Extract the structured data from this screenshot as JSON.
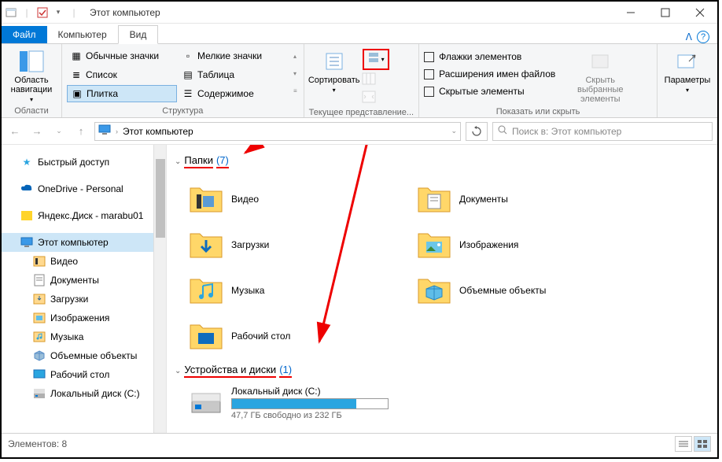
{
  "title": "Этот компьютер",
  "tabs": {
    "file": "Файл",
    "computer": "Компьютер",
    "view": "Вид"
  },
  "ribbon": {
    "navpane": {
      "btn": "Область навигации",
      "group": "Области"
    },
    "layout": {
      "opts": [
        "Обычные значки",
        "Мелкие значки",
        "Список",
        "Таблица",
        "Плитка",
        "Содержимое"
      ],
      "group": "Структура"
    },
    "sort": {
      "btn": "Сортировать",
      "group": "Текущее представление..."
    },
    "show": {
      "chk1": "Флажки элементов",
      "chk2": "Расширения имен файлов",
      "chk3": "Скрытые элементы",
      "hidebtn": "Скрыть выбранные элементы",
      "group": "Показать или скрыть"
    },
    "options": "Параметры"
  },
  "address": {
    "path": "Этот компьютер"
  },
  "search": {
    "placeholder": "Поиск в: Этот компьютер"
  },
  "sidebar": {
    "items": [
      {
        "label": "Быстрый доступ"
      },
      {
        "label": "OneDrive - Personal"
      },
      {
        "label": "Яндекс.Диск - marabu01"
      },
      {
        "label": "Этот компьютер"
      },
      {
        "label": "Видео"
      },
      {
        "label": "Документы"
      },
      {
        "label": "Загрузки"
      },
      {
        "label": "Изображения"
      },
      {
        "label": "Музыка"
      },
      {
        "label": "Объемные объекты"
      },
      {
        "label": "Рабочий стол"
      },
      {
        "label": "Локальный диск (C:)"
      }
    ]
  },
  "content": {
    "group1": {
      "title": "Папки",
      "count": "(7)"
    },
    "folders": [
      {
        "label": "Видео"
      },
      {
        "label": "Документы"
      },
      {
        "label": "Загрузки"
      },
      {
        "label": "Изображения"
      },
      {
        "label": "Музыка"
      },
      {
        "label": "Объемные объекты"
      },
      {
        "label": "Рабочий стол"
      }
    ],
    "group2": {
      "title": "Устройства и диски",
      "count": "(1)"
    },
    "disk": {
      "label": "Локальный диск (C:)",
      "info": "47,7 ГБ свободно из 232 ГБ"
    }
  },
  "status": {
    "text": "Элементов: 8"
  }
}
